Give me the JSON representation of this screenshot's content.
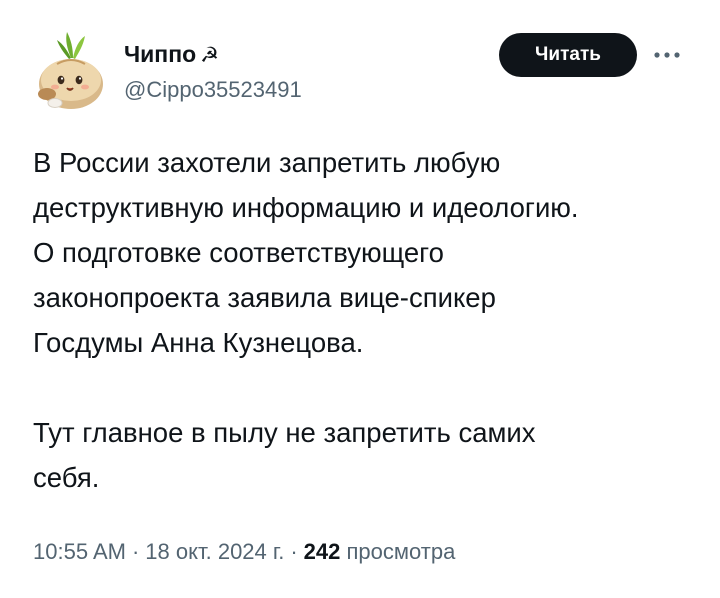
{
  "author": {
    "display_name": "Чиппо",
    "name_emoji": "☭",
    "handle": "@Cippo35523491"
  },
  "follow_button": {
    "label": "Читать"
  },
  "more_button": {
    "icon": "more-horizontal-icon"
  },
  "tweet": {
    "paragraphs": [
      "В России захотели запретить любую\nдеструктивную информацию и идеологию.\nО подготовке соответствующего\nзаконопроекта заявила вице-спикер\nГосдумы Анна Кузнецова.",
      "Тут главное в пылу не запретить самих\nсебя."
    ]
  },
  "meta": {
    "time": "10:55 AM",
    "date": "18 окт. 2024 г.",
    "separator": "·",
    "views_count": "242",
    "views_label": "просмотра"
  },
  "colors": {
    "text_primary": "#0f1419",
    "text_secondary": "#536471",
    "button_bg": "#0f1419",
    "button_text": "#ffffff"
  }
}
